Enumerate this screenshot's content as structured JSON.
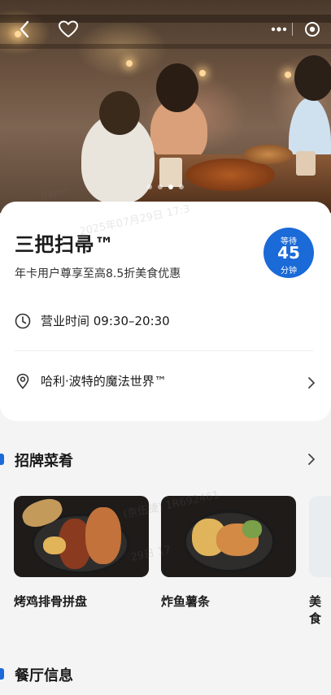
{
  "hero": {
    "pager_count": 4,
    "pager_active": 3
  },
  "restaurant": {
    "name": "三把扫帚™",
    "promo": "年卡用户尊享至高8.5折美食优惠",
    "wait_label": "等待",
    "wait_value": "45",
    "wait_unit": "分钟",
    "hours": "营业时间 09:30–20:30",
    "location": "哈利·波特的魔法世界™"
  },
  "signature": {
    "title": "招牌菜肴",
    "dishes": [
      {
        "name": "烤鸡排骨拼盘"
      },
      {
        "name": "炸鱼薯条"
      },
      {
        "name": "美食"
      }
    ]
  },
  "info": {
    "title": "餐厅信息"
  },
  "watermark": {
    "line1": "Jiajun",
    "line2": "2025年07月29日 17:3",
    "line3": "(京伍捷) 1R692461",
    "line4": "29日 17"
  },
  "colors": {
    "accent": "#1a6ad8"
  }
}
